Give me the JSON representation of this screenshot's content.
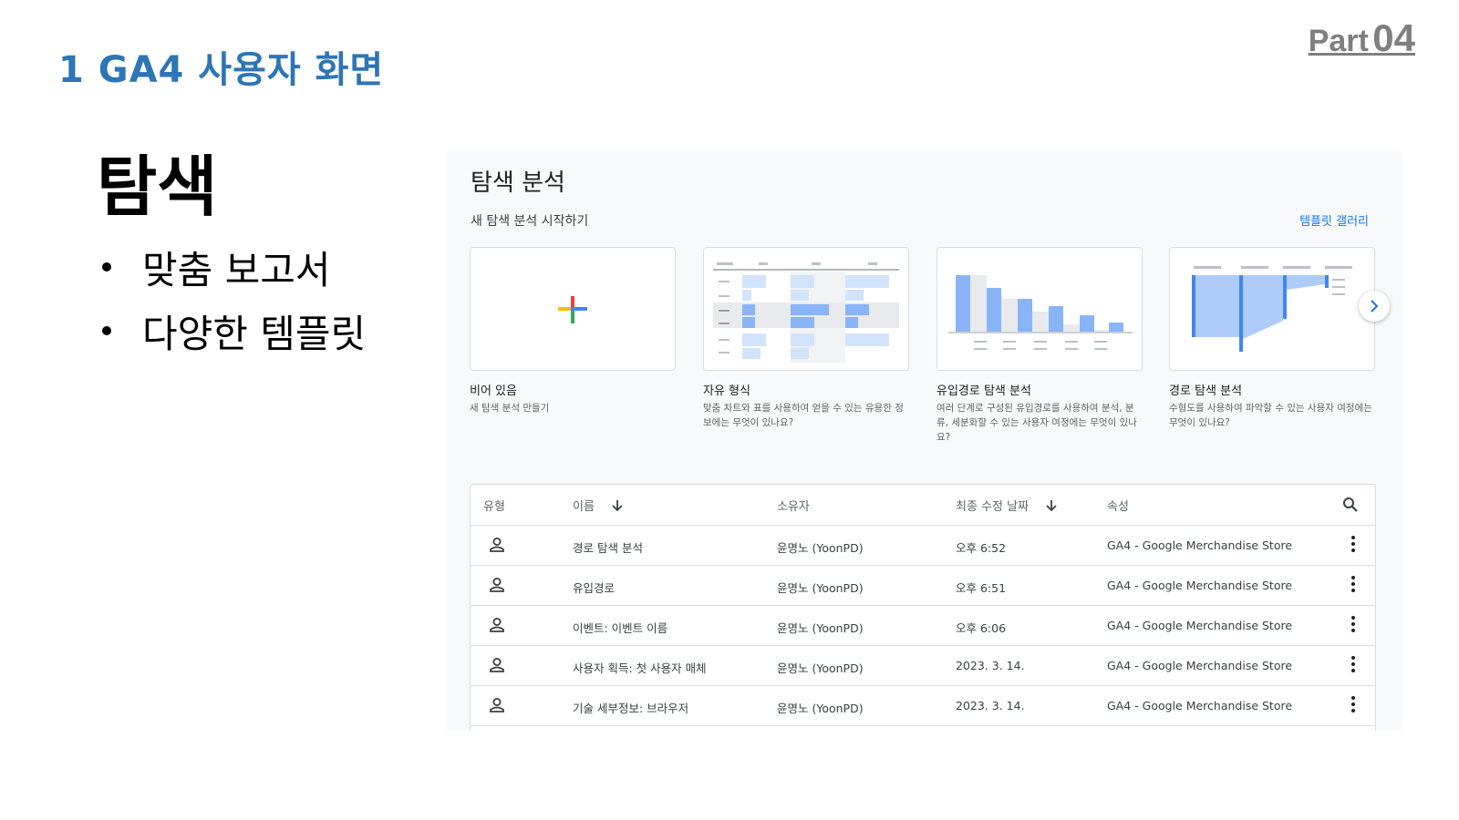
{
  "slide": {
    "section_title": "1 GA4 사용자 화면",
    "part_word": "Part",
    "part_number": "04",
    "main_title": "탐색",
    "bullets": [
      "맞춤 보고서",
      "다양한 템플릿"
    ]
  },
  "explore": {
    "title": "탐색 분석",
    "subtitle": "새 탐색 분석 시작하기",
    "gallery_link": "템플릿 갤러리",
    "cards": [
      {
        "label": "비어 있음",
        "desc": "새 탐색 분석 만들기"
      },
      {
        "label": "자유 형식",
        "desc": "맞춤 차트와 표를 사용하여 얻을 수 있는 유용한 정보에는 무엇이 있나요?"
      },
      {
        "label": "유입경로 탐색 분석",
        "desc": "여러 단계로 구성된 유입경로를 사용하여 분석, 분류, 세분화할 수 있는 사용자 여정에는 무엇이 있나요?"
      },
      {
        "label": "경로 탐색 분석",
        "desc": "수형도를 사용하여 파악할 수 있는 사용자 여정에는 무엇이 있나요?"
      }
    ],
    "next_icon": "chevron-right-icon",
    "colors": {
      "accent": "#1a73e8",
      "bar_blue": "#8ab4f8",
      "bar_light": "#d2e3fc"
    }
  },
  "table": {
    "headers": {
      "type": "유형",
      "name": "이름",
      "owner": "소유자",
      "modified": "최종 수정 날짜",
      "property": "속성"
    },
    "rows": [
      {
        "name": "경로 탐색 분석",
        "owner": "윤명노 (YoonPD)",
        "modified": "오후 6:52",
        "property": "GA4 - Google Merchandise Store"
      },
      {
        "name": "유입경로",
        "owner": "윤명노 (YoonPD)",
        "modified": "오후 6:51",
        "property": "GA4 - Google Merchandise Store"
      },
      {
        "name": "이벤트: 이벤트 이름",
        "owner": "윤명노 (YoonPD)",
        "modified": "오후 6:06",
        "property": "GA4 - Google Merchandise Store"
      },
      {
        "name": "사용자 획득: 첫 사용자 매체",
        "owner": "윤명노 (YoonPD)",
        "modified": "2023. 3. 14.",
        "property": "GA4 - Google Merchandise Store"
      },
      {
        "name": "기술 세부정보: 브라우저",
        "owner": "윤명노 (YoonPD)",
        "modified": "2023. 3. 14.",
        "property": "GA4 - Google Merchandise Store"
      }
    ]
  }
}
